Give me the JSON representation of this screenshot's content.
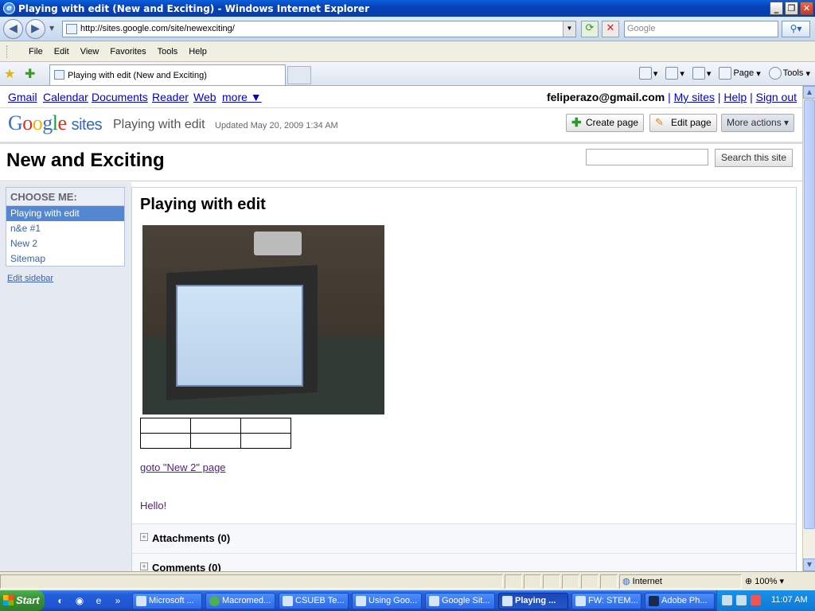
{
  "window": {
    "title": "Playing with edit (New and Exciting) - Windows Internet Explorer",
    "controls": [
      "_",
      "❐",
      "✕"
    ]
  },
  "address_bar": {
    "url": "http://sites.google.com/site/newexciting/",
    "search_placeholder": "Google"
  },
  "menu": [
    "File",
    "Edit",
    "View",
    "Favorites",
    "Tools",
    "Help"
  ],
  "tab": {
    "title": "Playing with edit (New and Exciting)"
  },
  "commandbar": {
    "page_label": "Page",
    "tools_label": "Tools"
  },
  "google_bar": {
    "links": [
      "Gmail",
      "Calendar",
      "Documents",
      "Reader",
      "Web",
      "more ▼"
    ],
    "email": "feliperazo@gmail.com",
    "my_sites": "My sites",
    "help": "Help",
    "sign_out": "Sign out",
    "sep": "|"
  },
  "header": {
    "logo_google": "Google",
    "logo_sites": "sites",
    "page_name": "Playing with edit",
    "updated": "Updated May 20, 2009 1:34 AM",
    "create_page": "Create page",
    "edit_page": "Edit page",
    "more_actions": "More actions ▾"
  },
  "site": {
    "title": "New and Exciting",
    "search_button": "Search this site"
  },
  "sidebar": {
    "heading": "CHOOSE ME:",
    "items": [
      "Playing with edit",
      "n&e #1",
      "New 2",
      "Sitemap"
    ],
    "selected": "Playing with edit",
    "edit_link": "Edit sidebar"
  },
  "content": {
    "title": "Playing with edit",
    "link": "goto \"New 2\" page",
    "hello": "Hello!",
    "table": {
      "rows": 2,
      "cols": 3
    },
    "attachments": "Attachments (0)",
    "comments": "Comments (0)"
  },
  "status": {
    "zone": "Internet",
    "zoom": "100%"
  },
  "taskbar": {
    "start": "Start",
    "tasks": [
      "Microsoft ...",
      "Macromed...",
      "CSUEB Te...",
      "Using Goo...",
      "Google Sit...",
      "Playing ...",
      "FW: STEM...",
      "Adobe Ph..."
    ],
    "active": "Playing ...",
    "clock": "11:07 AM"
  }
}
